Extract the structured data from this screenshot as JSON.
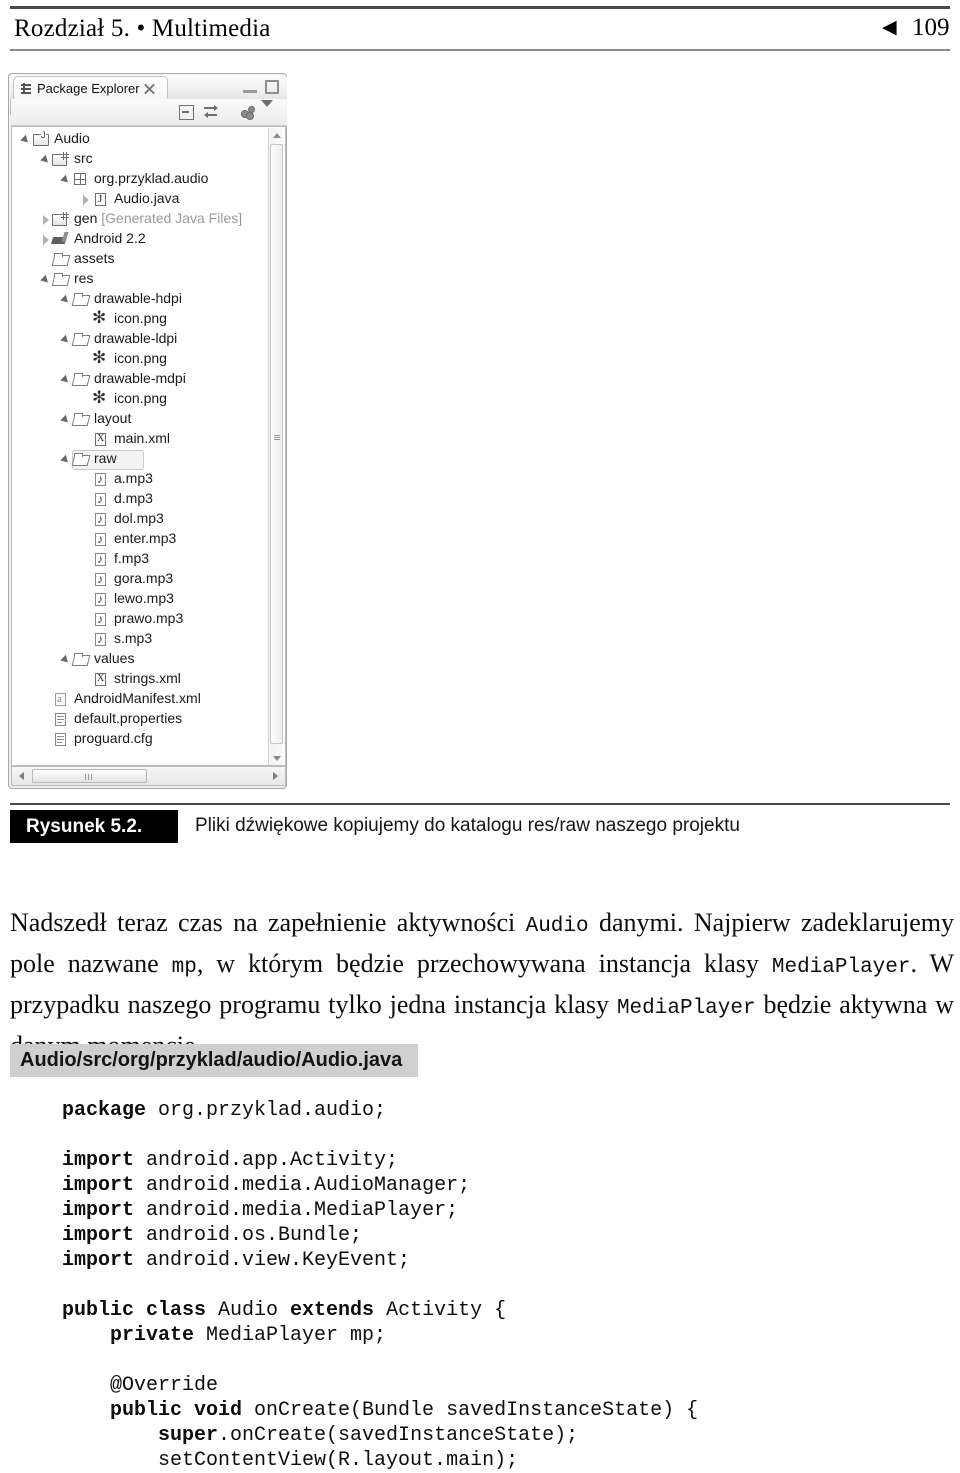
{
  "running_head": {
    "chapter_title": "Rozdział 5. • Multimedia",
    "back_arrow": "◀",
    "page_number": "109"
  },
  "figure": {
    "view_tab": {
      "label": "Package Explorer",
      "tab_icon": "package-explorer-icon",
      "close_icon": "close-icon",
      "minimize_icon": "minimize-icon",
      "maximize_icon": "maximize-icon"
    },
    "toolbar": {
      "collapse_all": "collapse-all-icon",
      "link_with_editor": "link-with-editor-icon",
      "view_menu": "view-menu-icon",
      "chevron": "chevron-down-icon"
    },
    "tree": [
      {
        "label": "Audio",
        "depth": 0,
        "twisty": "open",
        "icon": "project-icon"
      },
      {
        "label": "src",
        "depth": 1,
        "twisty": "open",
        "icon": "source-folder-icon"
      },
      {
        "label": "org.przyklad.audio",
        "depth": 2,
        "twisty": "open",
        "icon": "package-icon"
      },
      {
        "label": "Audio.java",
        "depth": 3,
        "twisty": "closed",
        "icon": "java-file-icon"
      },
      {
        "label": "gen",
        "suffix": " [Generated Java Files]",
        "depth": 1,
        "twisty": "closed",
        "icon": "source-folder-icon"
      },
      {
        "label": "Android 2.2",
        "depth": 1,
        "twisty": "closed",
        "icon": "android-library-icon"
      },
      {
        "label": "assets",
        "depth": 1,
        "twisty": "none",
        "icon": "folder-icon"
      },
      {
        "label": "res",
        "depth": 1,
        "twisty": "open",
        "icon": "folder-icon"
      },
      {
        "label": "drawable-hdpi",
        "depth": 2,
        "twisty": "open",
        "icon": "folder-icon"
      },
      {
        "label": "icon.png",
        "depth": 3,
        "twisty": "none",
        "icon": "png-icon"
      },
      {
        "label": "drawable-ldpi",
        "depth": 2,
        "twisty": "open",
        "icon": "folder-icon"
      },
      {
        "label": "icon.png",
        "depth": 3,
        "twisty": "none",
        "icon": "png-icon"
      },
      {
        "label": "drawable-mdpi",
        "depth": 2,
        "twisty": "open",
        "icon": "folder-icon"
      },
      {
        "label": "icon.png",
        "depth": 3,
        "twisty": "none",
        "icon": "png-icon"
      },
      {
        "label": "layout",
        "depth": 2,
        "twisty": "open",
        "icon": "folder-icon"
      },
      {
        "label": "main.xml",
        "depth": 3,
        "twisty": "none",
        "icon": "xml-file-icon"
      },
      {
        "label": "raw",
        "depth": 2,
        "twisty": "open",
        "icon": "folder-icon",
        "selected": true
      },
      {
        "label": "a.mp3",
        "depth": 3,
        "twisty": "none",
        "icon": "mp3-file-icon"
      },
      {
        "label": "d.mp3",
        "depth": 3,
        "twisty": "none",
        "icon": "mp3-file-icon"
      },
      {
        "label": "dol.mp3",
        "depth": 3,
        "twisty": "none",
        "icon": "mp3-file-icon"
      },
      {
        "label": "enter.mp3",
        "depth": 3,
        "twisty": "none",
        "icon": "mp3-file-icon"
      },
      {
        "label": "f.mp3",
        "depth": 3,
        "twisty": "none",
        "icon": "mp3-file-icon"
      },
      {
        "label": "gora.mp3",
        "depth": 3,
        "twisty": "none",
        "icon": "mp3-file-icon"
      },
      {
        "label": "lewo.mp3",
        "depth": 3,
        "twisty": "none",
        "icon": "mp3-file-icon"
      },
      {
        "label": "prawo.mp3",
        "depth": 3,
        "twisty": "none",
        "icon": "mp3-file-icon"
      },
      {
        "label": "s.mp3",
        "depth": 3,
        "twisty": "none",
        "icon": "mp3-file-icon"
      },
      {
        "label": "values",
        "depth": 2,
        "twisty": "open",
        "icon": "folder-icon"
      },
      {
        "label": "strings.xml",
        "depth": 3,
        "twisty": "none",
        "icon": "xml-file-icon"
      },
      {
        "label": "AndroidManifest.xml",
        "depth": 1,
        "twisty": "none",
        "icon": "manifest-file-icon"
      },
      {
        "label": "default.properties",
        "depth": 1,
        "twisty": "none",
        "icon": "properties-file-icon"
      },
      {
        "label": "proguard.cfg",
        "depth": 1,
        "twisty": "none",
        "icon": "properties-file-icon"
      }
    ],
    "scrollbars": {
      "vertical": "vertical-scrollbar",
      "horizontal": "horizontal-scrollbar"
    }
  },
  "caption": {
    "tag": "Rysunek 5.2.",
    "text": "Pliki dźwiękowe kopiujemy do katalogu res/raw naszego projektu"
  },
  "paragraph": {
    "part1": "Nadszedł teraz czas na zapełnienie aktywności ",
    "code1": "Audio",
    "part2": " danymi. Najpierw zadeklarujemy pole nazwane ",
    "code2": "mp",
    "part3": ", w którym będzie przechowywana instancja klasy ",
    "code3": "MediaPlayer",
    "part4": ". W przypadku naszego programu tylko jedna instancja klasy ",
    "code4": "MediaPlayer",
    "part5": " będzie aktywna w danym momencie."
  },
  "listing": {
    "title": "Audio/src/org/przyklad/audio/Audio.java",
    "lines": [
      {
        "segments": [
          {
            "t": "package",
            "b": true
          },
          {
            "t": " org.przyklad.audio;",
            "b": false
          }
        ]
      },
      {
        "blank": true
      },
      {
        "segments": [
          {
            "t": "import",
            "b": true
          },
          {
            "t": " android.app.Activity;",
            "b": false
          }
        ]
      },
      {
        "segments": [
          {
            "t": "import",
            "b": true
          },
          {
            "t": " android.media.AudioManager;",
            "b": false
          }
        ]
      },
      {
        "segments": [
          {
            "t": "import",
            "b": true
          },
          {
            "t": " android.media.MediaPlayer;",
            "b": false
          }
        ]
      },
      {
        "segments": [
          {
            "t": "import",
            "b": true
          },
          {
            "t": " android.os.Bundle;",
            "b": false
          }
        ]
      },
      {
        "segments": [
          {
            "t": "import",
            "b": true
          },
          {
            "t": " android.view.KeyEvent;",
            "b": false
          }
        ]
      },
      {
        "blank": true
      },
      {
        "segments": [
          {
            "t": "public class",
            "b": true
          },
          {
            "t": " Audio ",
            "b": false
          },
          {
            "t": "extends",
            "b": true
          },
          {
            "t": " Activity {",
            "b": false
          }
        ]
      },
      {
        "segments": [
          {
            "t": "    private",
            "b": true
          },
          {
            "t": " MediaPlayer mp;",
            "b": false
          }
        ]
      },
      {
        "blank": true
      },
      {
        "segments": [
          {
            "t": "    @Override",
            "b": false
          }
        ]
      },
      {
        "segments": [
          {
            "t": "    public void",
            "b": true
          },
          {
            "t": " onCreate(Bundle savedInstanceState) {",
            "b": false
          }
        ]
      },
      {
        "segments": [
          {
            "t": "        super",
            "b": true
          },
          {
            "t": ".onCreate(savedInstanceState);",
            "b": false
          }
        ]
      },
      {
        "segments": [
          {
            "t": "        setContentView(R.layout.main);",
            "b": false
          }
        ]
      }
    ]
  }
}
